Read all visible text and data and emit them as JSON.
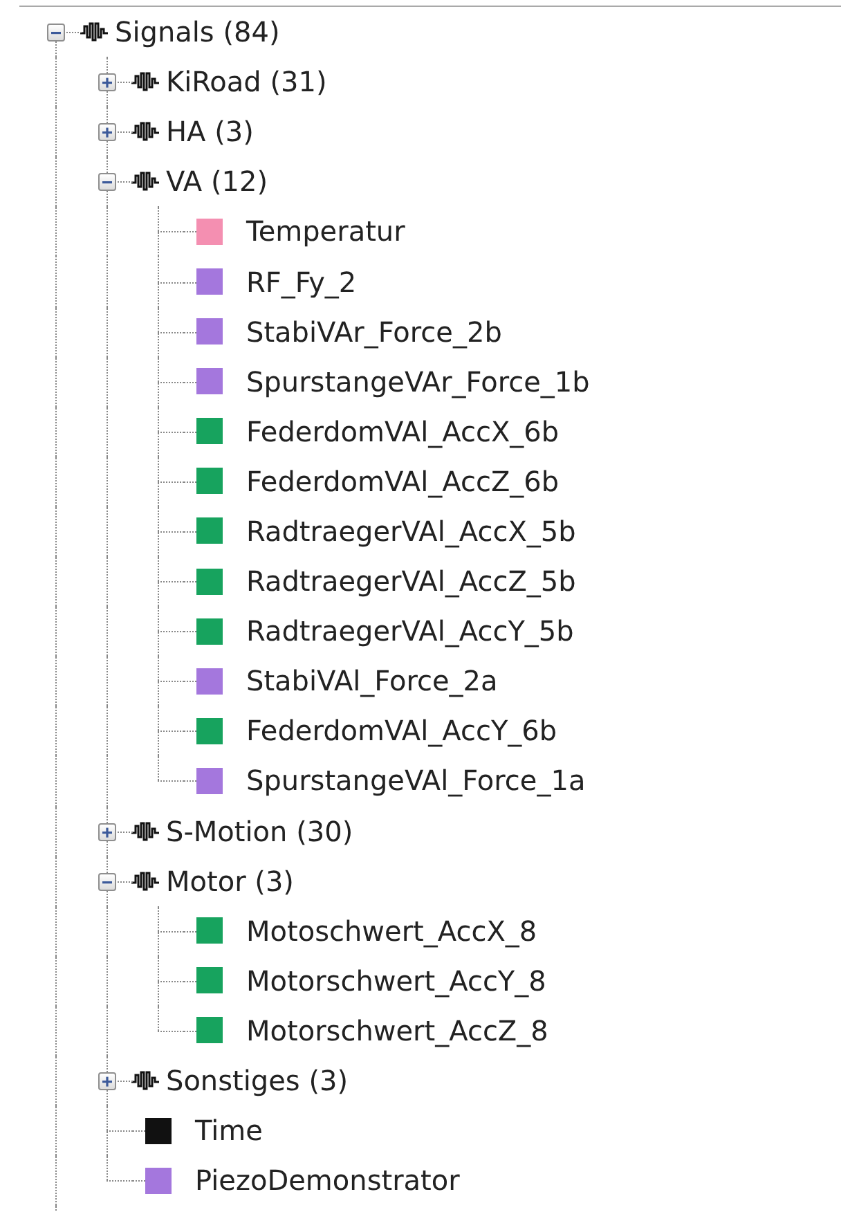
{
  "tree": [
    {
      "kind": "group",
      "label": "Signals (84)",
      "expanded": true,
      "children": [
        {
          "kind": "group",
          "label": "KiRoad (31)",
          "expanded": false
        },
        {
          "kind": "group",
          "label": "HA (3)",
          "expanded": false
        },
        {
          "kind": "group",
          "label": "VA (12)",
          "expanded": true,
          "children": [
            {
              "kind": "signal",
              "label": "Temperatur",
              "color": "#f48fb1"
            },
            {
              "kind": "signal",
              "label": "RF_Fy_2",
              "color": "#a477dd"
            },
            {
              "kind": "signal",
              "label": "StabiVAr_Force_2b",
              "color": "#a477dd"
            },
            {
              "kind": "signal",
              "label": "SpurstangeVAr_Force_1b",
              "color": "#a477dd"
            },
            {
              "kind": "signal",
              "label": "FederdomVAl_AccX_6b",
              "color": "#17a35e"
            },
            {
              "kind": "signal",
              "label": "FederdomVAl_AccZ_6b",
              "color": "#17a35e"
            },
            {
              "kind": "signal",
              "label": "RadtraegerVAl_AccX_5b",
              "color": "#17a35e"
            },
            {
              "kind": "signal",
              "label": "RadtraegerVAl_AccZ_5b",
              "color": "#17a35e"
            },
            {
              "kind": "signal",
              "label": "RadtraegerVAl_AccY_5b",
              "color": "#17a35e"
            },
            {
              "kind": "signal",
              "label": "StabiVAl_Force_2a",
              "color": "#a477dd"
            },
            {
              "kind": "signal",
              "label": "FederdomVAl_AccY_6b",
              "color": "#17a35e"
            },
            {
              "kind": "signal",
              "label": "SpurstangeVAl_Force_1a",
              "color": "#a477dd"
            }
          ]
        },
        {
          "kind": "group",
          "label": "S-Motion (30)",
          "expanded": false
        },
        {
          "kind": "group",
          "label": "Motor (3)",
          "expanded": true,
          "children": [
            {
              "kind": "signal",
              "label": "Motoschwert_AccX_8",
              "color": "#17a35e"
            },
            {
              "kind": "signal",
              "label": "Motorschwert_AccY_8",
              "color": "#17a35e"
            },
            {
              "kind": "signal",
              "label": "Motorschwert_AccZ_8",
              "color": "#17a35e"
            }
          ]
        },
        {
          "kind": "group",
          "label": "Sonstiges (3)",
          "expanded": false
        },
        {
          "kind": "signal",
          "label": "Time",
          "color": "#111111"
        },
        {
          "kind": "signal",
          "label": "PiezoDemonstrator",
          "color": "#a477dd"
        }
      ]
    }
  ]
}
